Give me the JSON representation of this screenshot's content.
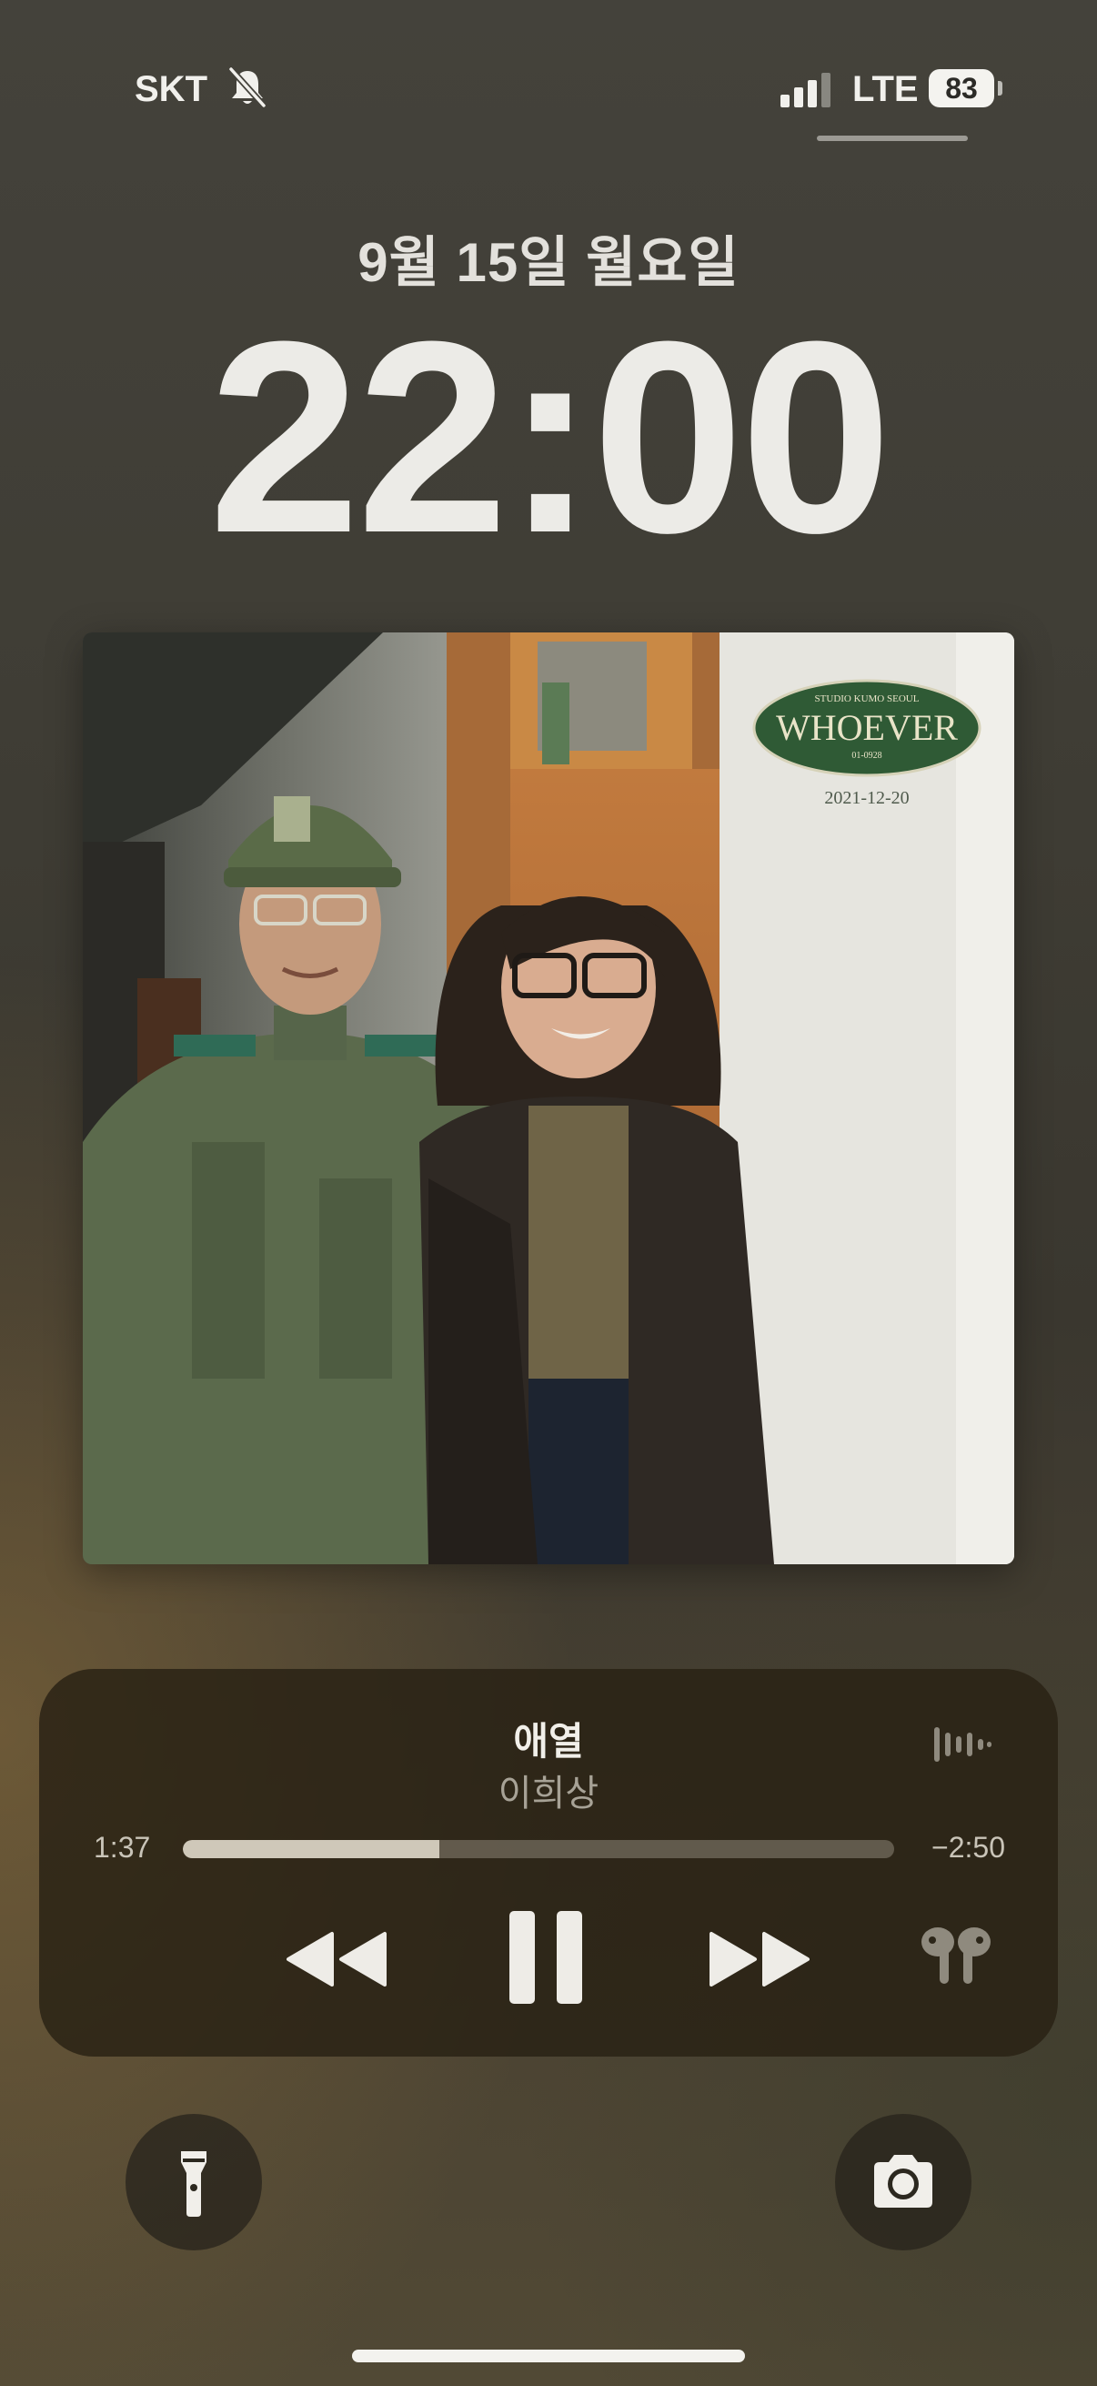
{
  "status_bar": {
    "carrier": "SKT",
    "mute_icon": "bell-slash-icon",
    "signal_icon": "cellular-signal-icon",
    "network": "LTE",
    "battery": "83"
  },
  "lock": {
    "date": "9월 15일 월요일",
    "time": "22:00"
  },
  "album_art": {
    "badge_top": "STUDIO KUMO SEOUL",
    "badge_title": "WHOEVER",
    "badge_sub": "01-0928",
    "date": "2021-12-20",
    "colors": {
      "badge": "#2f5a35",
      "wall": "#e6e5df",
      "door": "#b36a36"
    }
  },
  "now_playing": {
    "title": "애열",
    "artist": "이희상",
    "elapsed": "1:37",
    "remaining": "−2:50",
    "progress": 0.36,
    "controls": [
      "rewind-icon",
      "pause-icon",
      "fast-forward-icon"
    ],
    "output_icon": "airpods-icon",
    "wave_icon": "audio-waveform-icon"
  },
  "quick_actions": {
    "left": "flashlight-icon",
    "right": "camera-icon"
  }
}
